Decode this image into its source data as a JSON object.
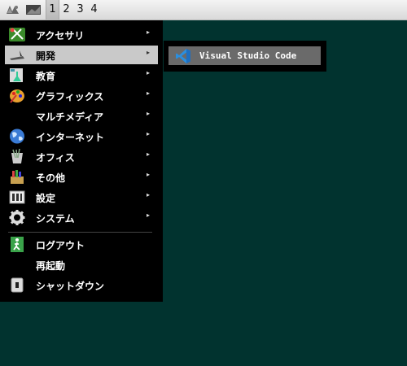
{
  "panel": {
    "menu_icon": "app-launcher-icon",
    "desktop_icon": "show-desktop-icon",
    "workspaces": [
      "1",
      "2",
      "3",
      "4"
    ],
    "active_workspace": "1"
  },
  "menu": {
    "items": [
      {
        "label": "アクセサリ",
        "icon": "accessories-icon",
        "submenu": true
      },
      {
        "label": "開発",
        "icon": "development-icon",
        "submenu": true,
        "highlighted": true
      },
      {
        "label": "教育",
        "icon": "education-icon",
        "submenu": true
      },
      {
        "label": "グラフィックス",
        "icon": "graphics-icon",
        "submenu": true
      },
      {
        "label": "マルチメディア",
        "icon": "",
        "submenu": true
      },
      {
        "label": "インターネット",
        "icon": "internet-icon",
        "submenu": true
      },
      {
        "label": "オフィス",
        "icon": "office-icon",
        "submenu": true
      },
      {
        "label": "その他",
        "icon": "other-icon",
        "submenu": true
      },
      {
        "label": "設定",
        "icon": "settings-icon",
        "submenu": true
      },
      {
        "label": "システム",
        "icon": "system-icon",
        "submenu": true
      },
      {
        "label": "ログアウト",
        "icon": "logout-icon",
        "submenu": false
      },
      {
        "label": "再起動",
        "icon": "",
        "submenu": false
      },
      {
        "label": "シャットダウン",
        "icon": "shutdown-icon",
        "submenu": false
      }
    ],
    "arrow": "▸"
  },
  "submenu": {
    "items": [
      {
        "label": "Visual Studio Code",
        "icon": "vscode-icon"
      }
    ]
  },
  "colors": {
    "desktop": "#01332f",
    "menu_bg": "#000000",
    "highlight": "#c9c9c9",
    "submenu_highlight": "#6a6a6a",
    "vscode_blue": "#2a8fe0"
  }
}
